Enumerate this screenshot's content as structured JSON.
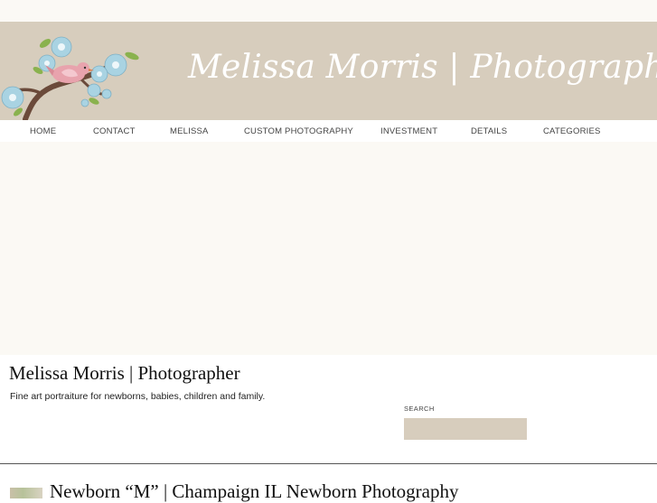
{
  "header": {
    "banner_title": "Melissa Morris | Photographer"
  },
  "nav": {
    "items": [
      {
        "label": "HOME"
      },
      {
        "label": "CONTACT"
      },
      {
        "label": "MELISSA"
      },
      {
        "label": "CUSTOM PHOTOGRAPHY"
      },
      {
        "label": "INVESTMENT"
      },
      {
        "label": "DETAILS"
      },
      {
        "label": "CATEGORIES"
      }
    ]
  },
  "site": {
    "title": "Melissa Morris | Photographer",
    "tagline": "Fine art portraiture for newborns, babies, children and family."
  },
  "search": {
    "label": "SEARCH",
    "value": ""
  },
  "post": {
    "title": "Newborn “M” | Champaign IL Newborn Photography"
  },
  "colors": {
    "banner_bg": "#d7cdbd",
    "hero_bg": "#fbf9f4",
    "bird_pink": "#e8a3ad",
    "flower_blue": "#a9d3e2",
    "branch_brown": "#6b4a3a",
    "leaf_green": "#8ab24e"
  }
}
